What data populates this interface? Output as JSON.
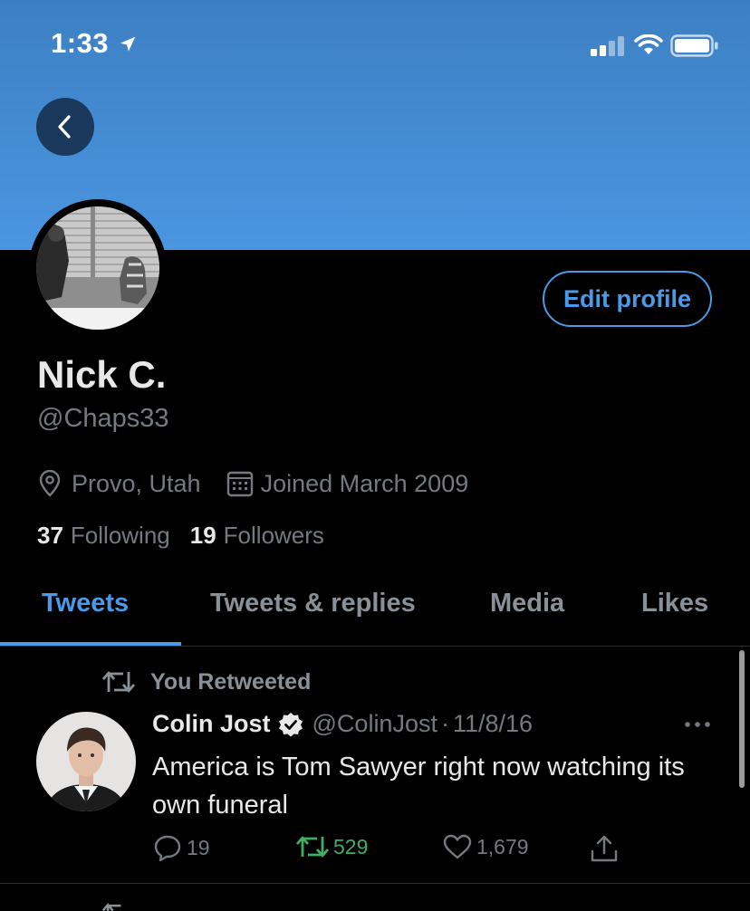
{
  "status_bar": {
    "time": "1:33"
  },
  "profile": {
    "back_icon": "chevron-left-icon",
    "edit_label": "Edit profile",
    "name": "Nick C.",
    "handle": "@Chaps33",
    "location": "Provo, Utah",
    "joined": "Joined March 2009",
    "following_count": "37",
    "following_label": "Following",
    "followers_count": "19",
    "followers_label": "Followers"
  },
  "tabs": [
    {
      "label": "Tweets",
      "active": true
    },
    {
      "label": "Tweets & replies",
      "active": false
    },
    {
      "label": "Media",
      "active": false
    },
    {
      "label": "Likes",
      "active": false
    }
  ],
  "tweet": {
    "retweet_note": "You Retweeted",
    "author_name": "Colin Jost",
    "author_handle": "@ColinJost",
    "separator": "·",
    "date": "11/8/16",
    "text": "America is Tom Sawyer right now watching its own funeral",
    "replies": "19",
    "retweets": "529",
    "likes": "1,679"
  },
  "colors": {
    "accent": "#4a9ae8",
    "retweet": "#3fae63",
    "banner": "#4a96e0",
    "muted": "#747a80"
  }
}
